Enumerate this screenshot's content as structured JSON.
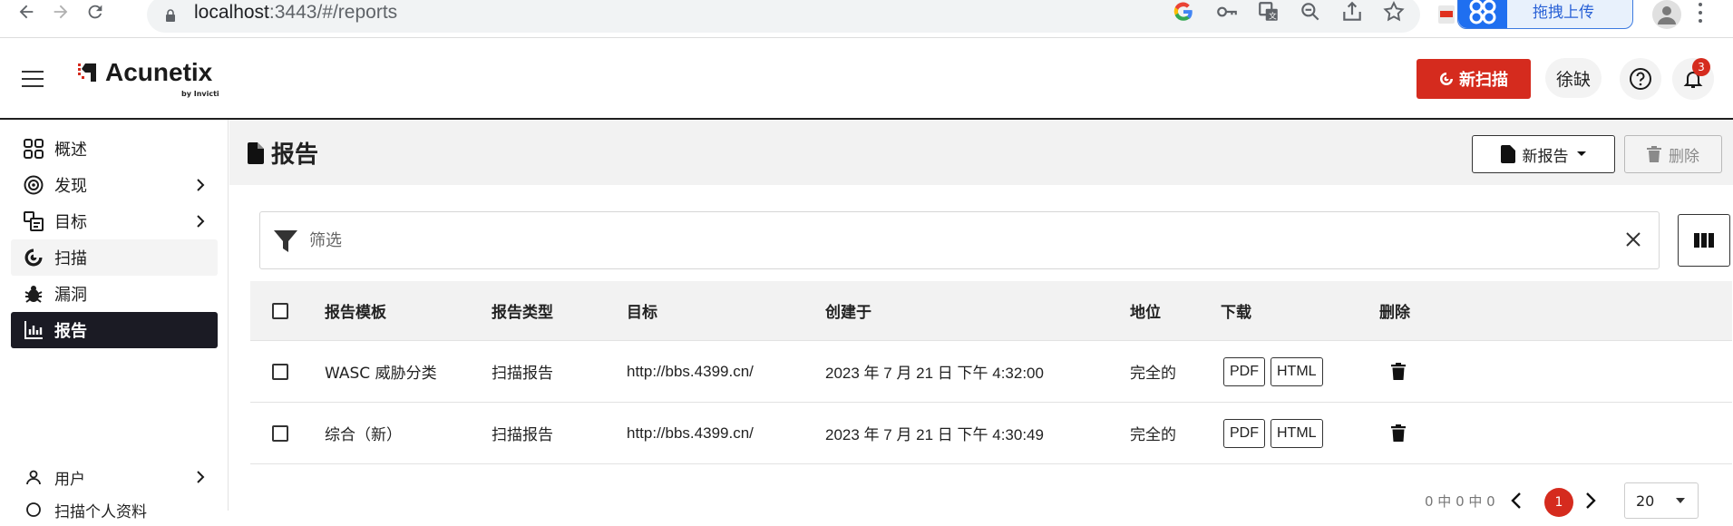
{
  "browser": {
    "url_host": "localhost",
    "url_rest": ":3443/#/reports",
    "extension_label": "拖拽上传",
    "icons": [
      "back-icon",
      "forward-icon",
      "reload-icon",
      "lock-icon",
      "google-icon",
      "key-icon",
      "translate-icon",
      "zoom-out-icon",
      "share-icon",
      "star-icon",
      "pdf-extension-icon",
      "profile-icon"
    ]
  },
  "header": {
    "brand_name": "Acunetix",
    "brand_by": "by Invicti",
    "new_scan_label": "新扫描",
    "user_label": "徐缺",
    "notification_count": "3",
    "accent_color": "#d52b1e"
  },
  "sidebar": {
    "items": [
      {
        "label": "概述",
        "icon": "dashboard-icon",
        "has_children": false
      },
      {
        "label": "发现",
        "icon": "target-circle-icon",
        "has_children": true
      },
      {
        "label": "目标",
        "icon": "targets-icon",
        "has_children": true
      },
      {
        "label": "扫描",
        "icon": "scan-icon",
        "has_children": false
      },
      {
        "label": "漏洞",
        "icon": "bug-icon",
        "has_children": false
      },
      {
        "label": "报告",
        "icon": "chart-icon",
        "has_children": false,
        "active": true
      }
    ],
    "bottom_items": [
      {
        "label": "用户",
        "icon": "user-icon",
        "has_children": true
      },
      {
        "label": "扫描个人资料",
        "icon": "profile-icon"
      }
    ]
  },
  "page": {
    "title": "报告",
    "new_report_label": "新报告",
    "delete_label": "删除",
    "filter_placeholder": "筛选"
  },
  "table": {
    "columns": [
      "报告模板",
      "报告类型",
      "目标",
      "创建于",
      "地位",
      "下载",
      "删除"
    ],
    "rows": [
      {
        "template": "WASC 威胁分类",
        "type": "扫描报告",
        "target": "http://bbs.4399.cn/",
        "created": "2023 年 7 月 21 日 下午 4:32:00",
        "status": "完全的",
        "downloads": [
          "PDF",
          "HTML"
        ]
      },
      {
        "template": "综合（新）",
        "type": "扫描报告",
        "target": "http://bbs.4399.cn/",
        "created": "2023 年 7 月 21 日 下午 4:30:49",
        "status": "完全的",
        "downloads": [
          "PDF",
          "HTML"
        ]
      }
    ]
  },
  "pagination": {
    "info": "0 中 0 中 0",
    "current_page": "1",
    "page_size": "20"
  }
}
